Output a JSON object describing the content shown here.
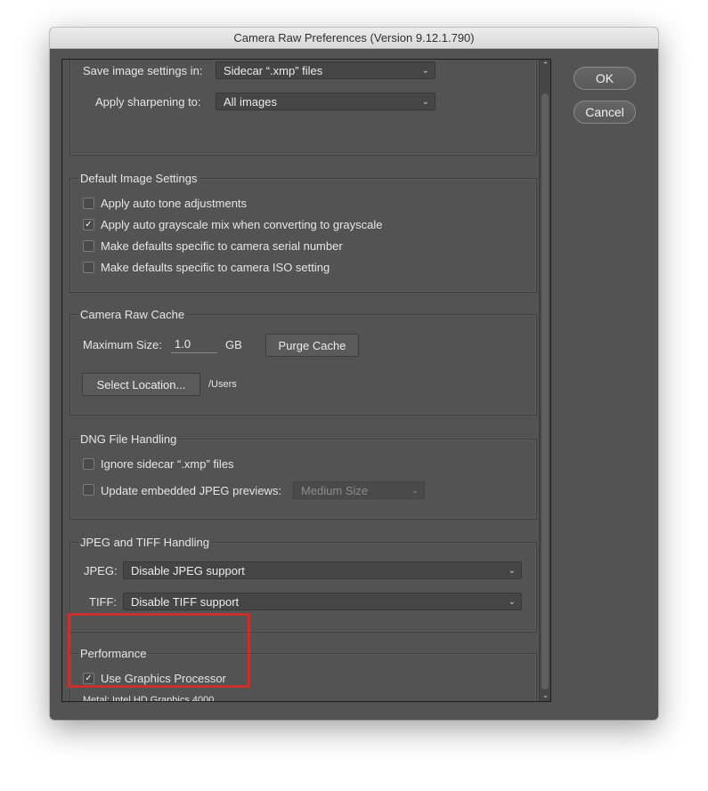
{
  "window": {
    "title": "Camera Raw Preferences  (Version 9.12.1.790)"
  },
  "buttons": {
    "ok": "OK",
    "cancel": "Cancel"
  },
  "general": {
    "save_label": "Save image settings in:",
    "save_value": "Sidecar “.xmp” files",
    "sharpen_label": "Apply sharpening to:",
    "sharpen_value": "All images"
  },
  "defaults": {
    "title": "Default Image Settings",
    "items": [
      {
        "label": "Apply auto tone adjustments",
        "checked": false
      },
      {
        "label": "Apply auto grayscale mix when converting to grayscale",
        "checked": true
      },
      {
        "label": "Make defaults specific to camera serial number",
        "checked": false
      },
      {
        "label": "Make defaults specific to camera ISO setting",
        "checked": false
      }
    ]
  },
  "cache": {
    "title": "Camera Raw Cache",
    "max_label": "Maximum Size:",
    "max_value": "1.0",
    "unit": "GB",
    "purge": "Purge Cache",
    "select_location": "Select Location...",
    "path": "/Users"
  },
  "dng": {
    "title": "DNG File Handling",
    "ignore_label": "Ignore sidecar “.xmp” files",
    "ignore_checked": false,
    "update_label": "Update embedded JPEG previews:",
    "update_checked": false,
    "preview_value": "Medium Size"
  },
  "jpegtiff": {
    "title": "JPEG and TIFF Handling",
    "jpeg_label": "JPEG:",
    "jpeg_value": "Disable JPEG support",
    "tiff_label": "TIFF:",
    "tiff_value": "Disable TIFF support"
  },
  "performance": {
    "title": "Performance",
    "gpu_label": "Use Graphics Processor",
    "gpu_checked": true,
    "gpu_info": "Metal: Intel HD Graphics 4000"
  },
  "colors": {
    "highlight": "#c6312e",
    "panel": "#535353"
  }
}
